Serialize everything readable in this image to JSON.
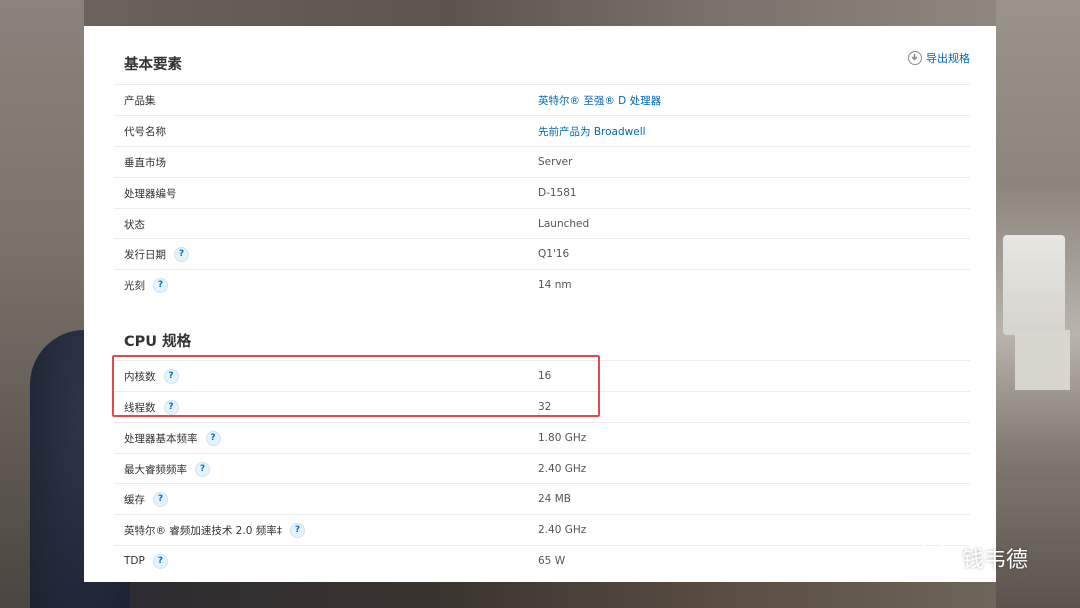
{
  "export_label": "导出规格",
  "basic_section": {
    "title": "基本要素",
    "rows": [
      {
        "label": "产品集",
        "value": "英特尔® 至强® D 处理器",
        "help": false,
        "link": true
      },
      {
        "label": "代号名称",
        "value": "先前产品为 Broadwell",
        "help": false,
        "link": true
      },
      {
        "label": "垂直市场",
        "value": "Server",
        "help": false,
        "link": false
      },
      {
        "label": "处理器编号",
        "value": "D-1581",
        "help": false,
        "link": false
      },
      {
        "label": "状态",
        "value": "Launched",
        "help": false,
        "link": false
      },
      {
        "label": "发行日期",
        "value": "Q1'16",
        "help": true,
        "link": false
      },
      {
        "label": "光刻",
        "value": "14 nm",
        "help": true,
        "link": false
      }
    ]
  },
  "cpu_section": {
    "title": "CPU 规格",
    "rows": [
      {
        "label": "内核数",
        "value": "16",
        "help": true,
        "link": false
      },
      {
        "label": "线程数",
        "value": "32",
        "help": true,
        "link": false
      },
      {
        "label": "处理器基本频率",
        "value": "1.80 GHz",
        "help": true,
        "link": false
      },
      {
        "label": "最大睿频频率",
        "value": "2.40 GHz",
        "help": true,
        "link": false
      },
      {
        "label": "缓存",
        "value": "24 MB",
        "help": true,
        "link": false
      },
      {
        "label": "英特尔® 睿频加速技术 2.0 频率‡",
        "value": "2.40 GHz",
        "help": true,
        "link": false
      },
      {
        "label": "TDP",
        "value": "65 W",
        "help": true,
        "link": false
      }
    ]
  },
  "help_glyph": "?",
  "watermark": "钱韦德",
  "colors": {
    "link": "#0068b5",
    "highlight": "#e04a4a",
    "help_icon": "#0071c5"
  }
}
